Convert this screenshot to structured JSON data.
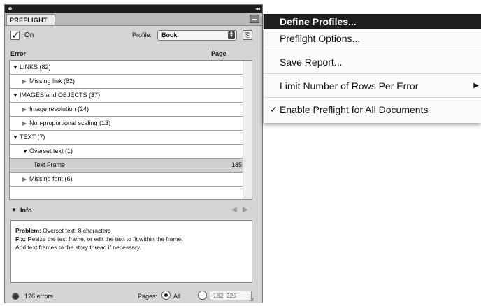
{
  "panel": {
    "tab_label": "PREFLIGHT",
    "on_label": "On",
    "on_checked": true,
    "profile_label": "Profile:",
    "profile_value": "Book",
    "col_error": "Error",
    "col_page": "Page",
    "errors": [
      {
        "label": "LINKS (82)",
        "level": 0,
        "expanded": true,
        "page": ""
      },
      {
        "label": "Missing link (82)",
        "level": 1,
        "expanded": false,
        "page": ""
      },
      {
        "label": "IMAGES and OBJECTS (37)",
        "level": 0,
        "expanded": true,
        "page": ""
      },
      {
        "label": "Image resolution (24)",
        "level": 1,
        "expanded": false,
        "page": ""
      },
      {
        "label": "Non-proportional scaling (13)",
        "level": 1,
        "expanded": false,
        "page": ""
      },
      {
        "label": "TEXT (7)",
        "level": 0,
        "expanded": true,
        "page": ""
      },
      {
        "label": "Overset text (1)",
        "level": 1,
        "expanded": true,
        "page": ""
      },
      {
        "label": "Text Frame",
        "level": 2,
        "expanded": null,
        "page": "185",
        "selected": true
      },
      {
        "label": "Missing font (6)",
        "level": 1,
        "expanded": false,
        "page": ""
      }
    ],
    "info_label": "Info",
    "info": {
      "problem_label": "Problem:",
      "problem_text": "Overset text: 8 characters",
      "fix_label": "Fix:",
      "fix_text": "Resize the text frame, or edit the text to fit within the frame.",
      "fix_text2": "Add text frames to the story thread if necessary."
    },
    "status_text": "126 errors",
    "pages_label": "Pages:",
    "pages_all": "All",
    "pages_range": "182–225"
  },
  "menu": {
    "items": [
      {
        "label": "Define Profiles...",
        "highlighted": true
      },
      {
        "label": "Preflight Options..."
      },
      {
        "label": "Save Report..."
      },
      {
        "label": "Limit Number of Rows Per Error",
        "submenu": true
      },
      {
        "label": "Enable Preflight for All Documents",
        "checked": true
      }
    ]
  }
}
